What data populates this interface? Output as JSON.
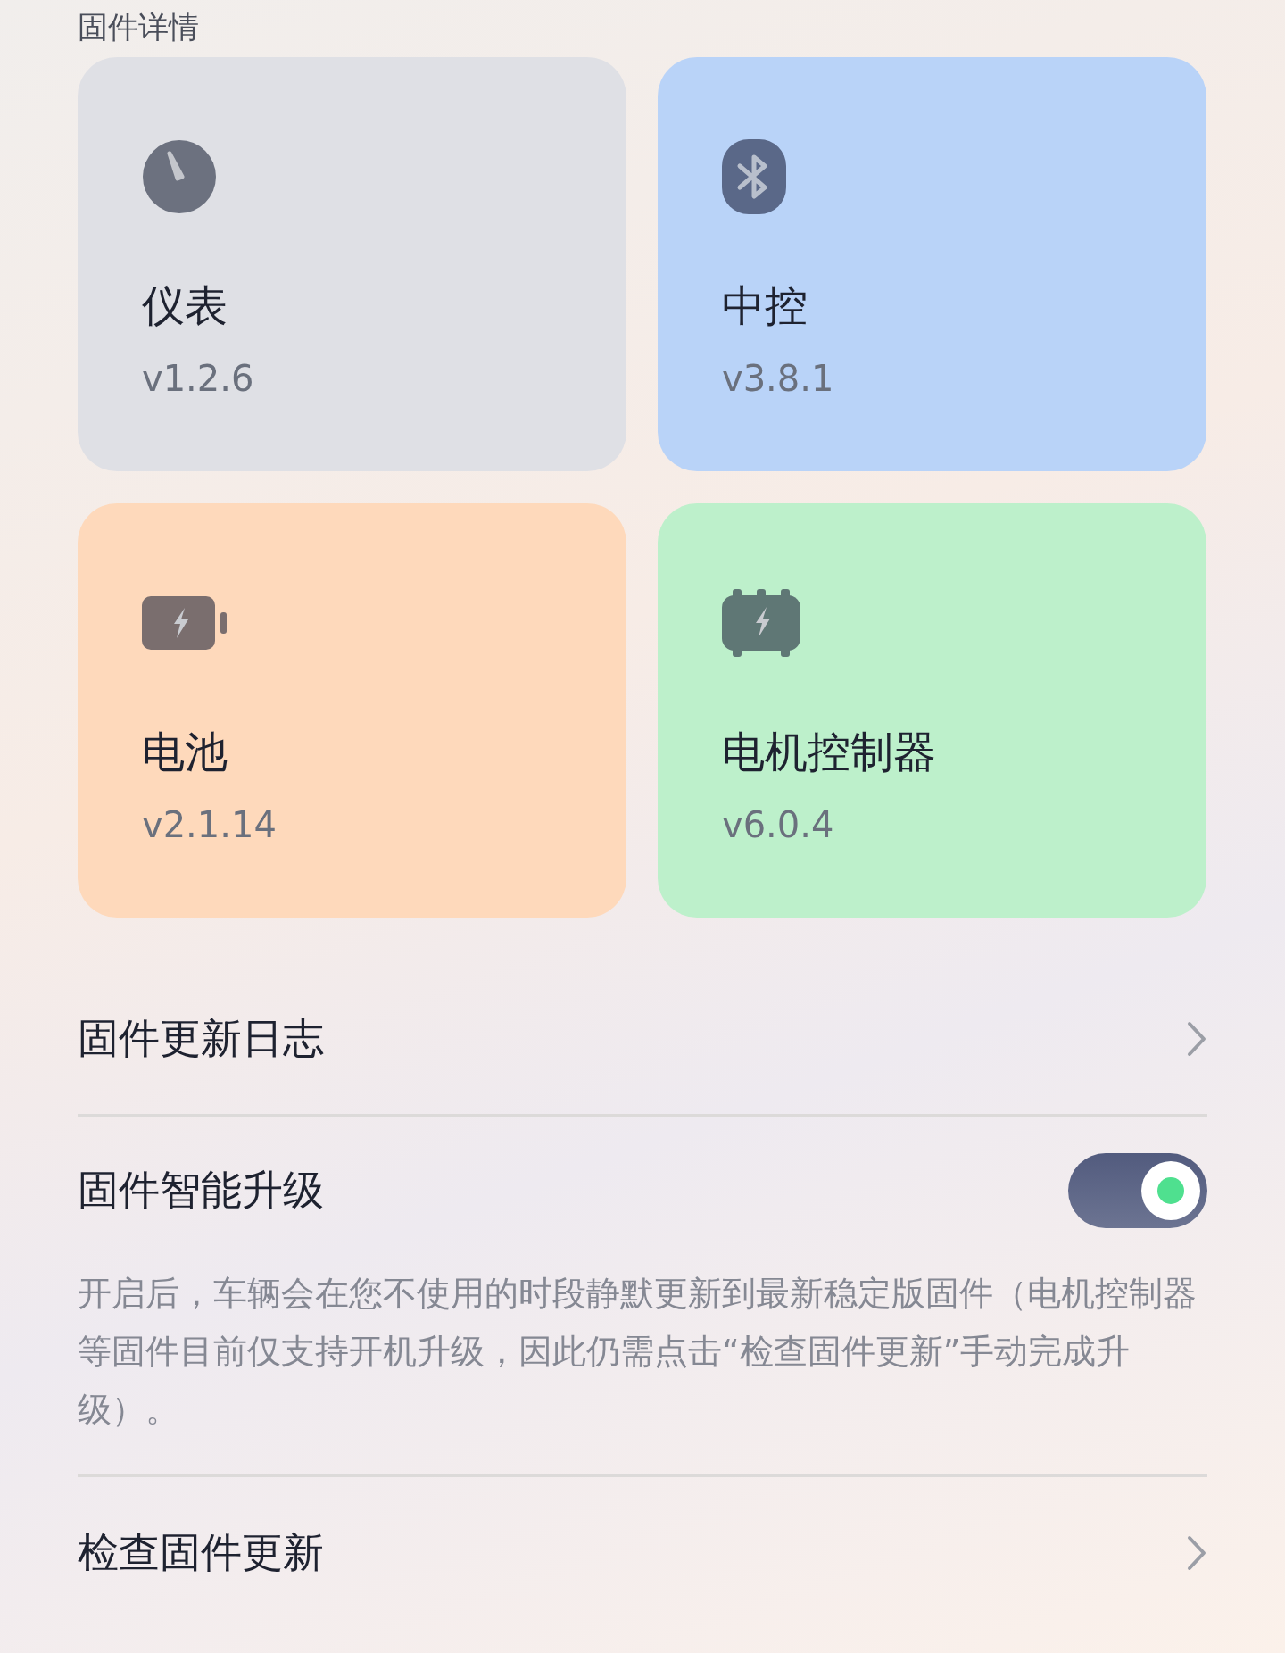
{
  "section_title": "固件详情",
  "modules": [
    {
      "kind": "gauge",
      "name": "仪表",
      "version": "v1.2.6",
      "color": "#dfe0e5"
    },
    {
      "kind": "bluetooth",
      "name": "中控",
      "version": "v3.8.1",
      "color": "#b9d3f8"
    },
    {
      "kind": "battery",
      "name": "电池",
      "version": "v2.1.14",
      "color": "#fed9bb"
    },
    {
      "kind": "motor",
      "name": "电机控制器",
      "version": "v6.0.4",
      "color": "#bdf0cb"
    }
  ],
  "rows": [
    {
      "kind": "link",
      "label": "固件更新日志"
    },
    {
      "kind": "toggle",
      "label": "固件智能升级",
      "on": true,
      "description": "开启后，车辆会在您不使用的时段静默更新到最新稳定版固件（电机控制器等固件目前仅支持开机升级，因此仍需点击“检查固件更新”手动完成升级）。"
    },
    {
      "kind": "link",
      "label": "检查固件更新"
    }
  ]
}
